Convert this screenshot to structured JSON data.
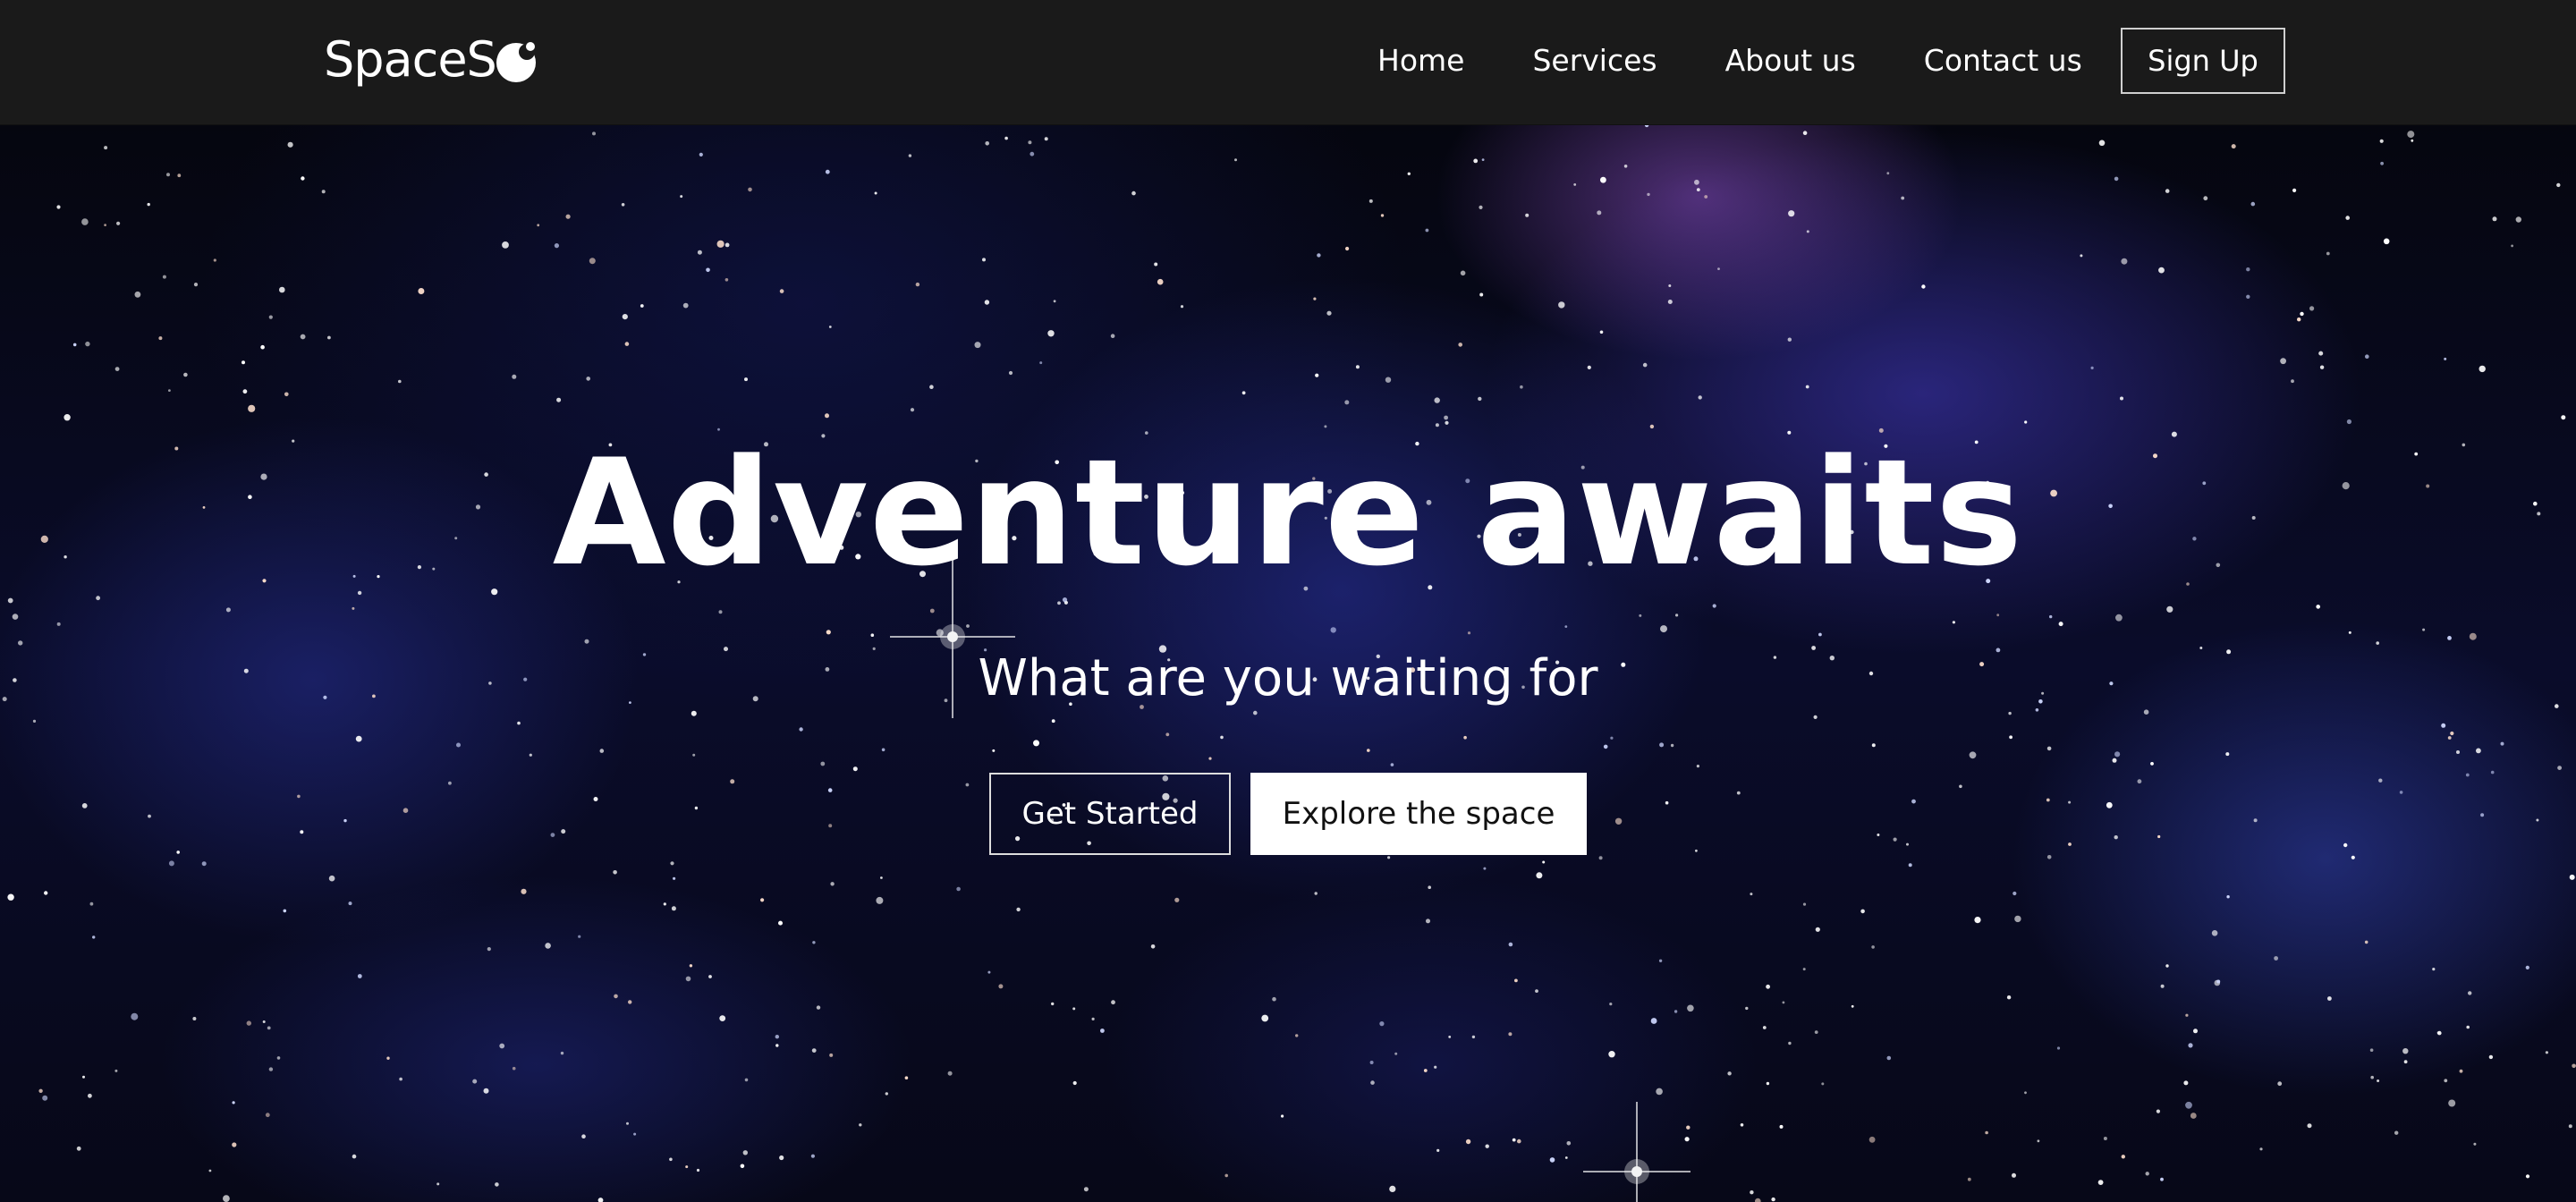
{
  "nav": {
    "logo_text": "SpaceS",
    "logo_icon": "planet-icon",
    "links": [
      {
        "label": "Home"
      },
      {
        "label": "Services"
      },
      {
        "label": "About us"
      },
      {
        "label": "Contact us"
      }
    ],
    "signup_label": "Sign Up"
  },
  "hero": {
    "title": "Adventure awaits",
    "subtitle": "What are you waiting for",
    "primary_button": "Get Started",
    "secondary_button": "Explore the space",
    "background": "starfield-nebula"
  },
  "colors": {
    "nav_background": "#1a1a1a",
    "text": "#ffffff",
    "secondary_button_background": "#ffffff",
    "secondary_button_text": "#111111"
  }
}
